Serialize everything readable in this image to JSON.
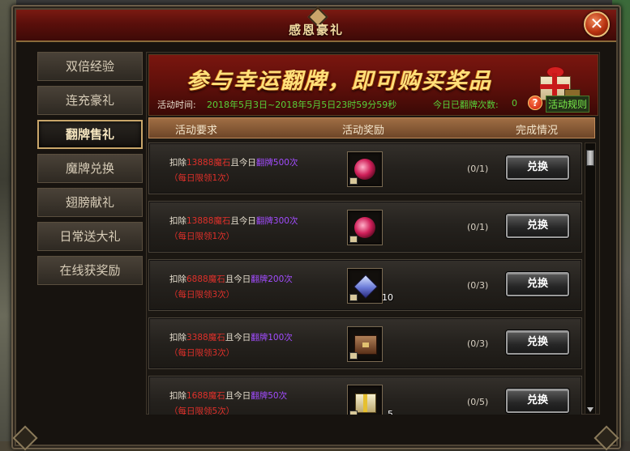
{
  "window": {
    "title": "感恩豪礼",
    "close_label": "✕"
  },
  "nav": {
    "items": [
      {
        "label": "双倍经验",
        "active": false
      },
      {
        "label": "连充豪礼",
        "active": false
      },
      {
        "label": "翻牌售礼",
        "active": true
      },
      {
        "label": "魔牌兑换",
        "active": false
      },
      {
        "label": "翅膀献礼",
        "active": false
      },
      {
        "label": "日常送大礼",
        "active": false
      },
      {
        "label": "在线获奖励",
        "active": false
      }
    ]
  },
  "banner": {
    "headline": "参与幸运翻牌，即可购买奖品",
    "time_label": "活动时间:",
    "time_value": "2018年5月3日~2018年5月5日23时59分59秒",
    "today_label": "今日已翻牌次数:",
    "today_count": "0",
    "help_icon": "?",
    "rules_link": "活动规则"
  },
  "table": {
    "headers": {
      "requirement": "活动要求",
      "reward": "活动奖励",
      "status": "完成情况"
    },
    "rows": [
      {
        "pre": "扣除",
        "stones": "13888魔石",
        "mid": "且今日",
        "flips": "翻牌500次",
        "limit": "（每日限领1次）",
        "reward_icon": "red-orb-icon",
        "reward_qty": "",
        "progress": "(0/1)",
        "button": "兑换"
      },
      {
        "pre": "扣除",
        "stones": "13888魔石",
        "mid": "且今日",
        "flips": "翻牌300次",
        "limit": "（每日限领1次）",
        "reward_icon": "red-orb-icon",
        "reward_qty": "",
        "progress": "(0/1)",
        "button": "兑换"
      },
      {
        "pre": "扣除",
        "stones": "6888魔石",
        "mid": "且今日",
        "flips": "翻牌200次",
        "limit": "（每日限领3次）",
        "reward_icon": "blue-cube-icon",
        "reward_qty": "10",
        "progress": "(0/3)",
        "button": "兑换"
      },
      {
        "pre": "扣除",
        "stones": "3388魔石",
        "mid": "且今日",
        "flips": "翻牌100次",
        "limit": "（每日限领3次）",
        "reward_icon": "chest-icon",
        "reward_qty": "",
        "progress": "(0/3)",
        "button": "兑换"
      },
      {
        "pre": "扣除",
        "stones": "1688魔石",
        "mid": "且今日",
        "flips": "翻牌50次",
        "limit": "（每日限领5次）",
        "reward_icon": "gift-box-icon",
        "reward_qty": "5",
        "progress": "(0/5)",
        "button": "兑换"
      }
    ]
  }
}
